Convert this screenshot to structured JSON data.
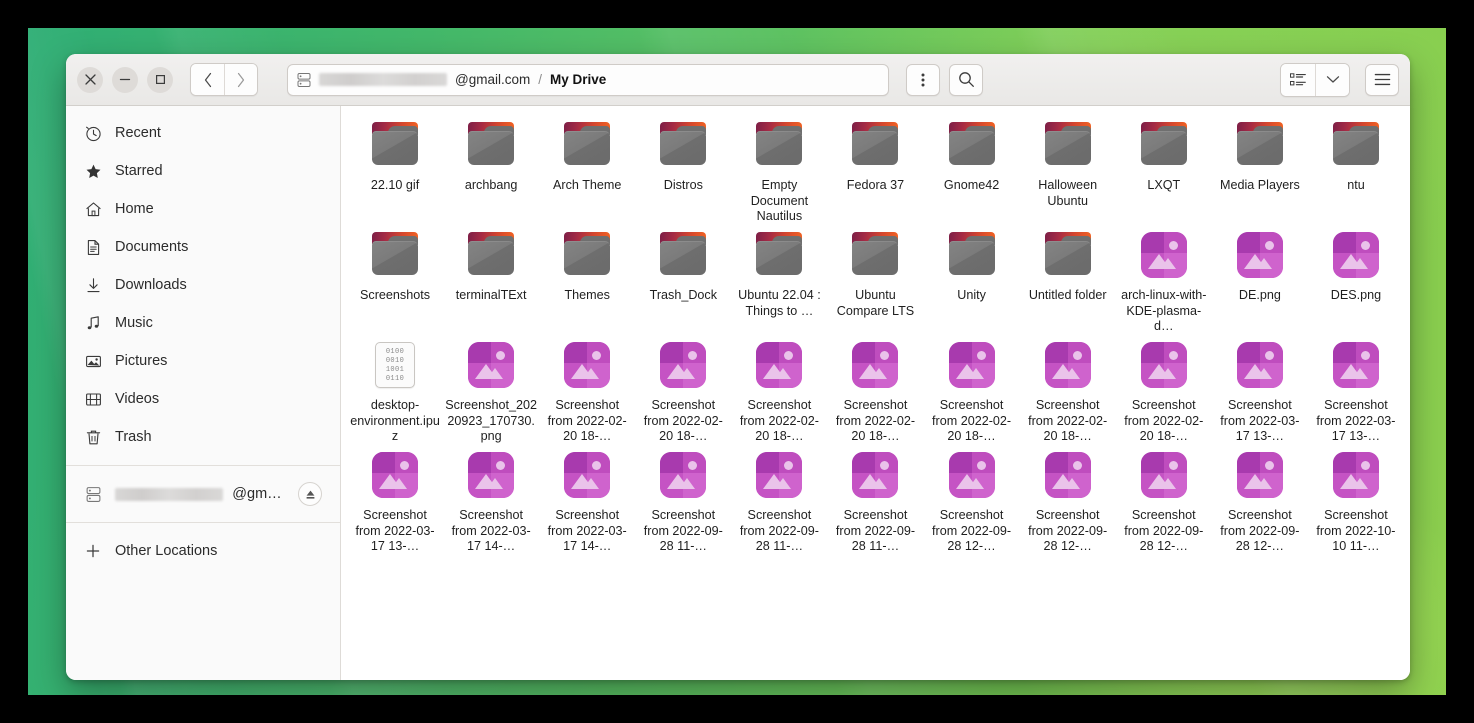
{
  "window": {
    "controls": {
      "close": "×",
      "minimize": "−",
      "maximize": "□"
    },
    "nav": {
      "back": "‹",
      "forward": "›"
    }
  },
  "pathbar": {
    "icon": "drive-icon",
    "account_redacted": true,
    "account_suffix": "@gmail.com",
    "separator": "/",
    "current": "My Drive"
  },
  "toolbar": {
    "menu_label": "⋮",
    "search_label": "search-icon",
    "view_list_label": "list-view-icon",
    "view_dropdown_label": "⌄",
    "hamburger_label": "≡"
  },
  "sidebar": {
    "items": [
      {
        "label": "Recent",
        "icon": "clock-icon"
      },
      {
        "label": "Starred",
        "icon": "star-icon"
      },
      {
        "label": "Home",
        "icon": "home-icon"
      },
      {
        "label": "Documents",
        "icon": "document-icon"
      },
      {
        "label": "Downloads",
        "icon": "download-icon"
      },
      {
        "label": "Music",
        "icon": "music-note-icon"
      },
      {
        "label": "Pictures",
        "icon": "picture-icon"
      },
      {
        "label": "Videos",
        "icon": "film-icon"
      },
      {
        "label": "Trash",
        "icon": "trash-icon"
      }
    ],
    "mount": {
      "label": "@gma…",
      "icon": "drive-icon",
      "eject": "eject-icon",
      "redacted": true
    },
    "other_locations": {
      "label": "Other Locations",
      "icon": "plus-icon"
    }
  },
  "files": [
    {
      "name": "22.10 gif",
      "type": "folder"
    },
    {
      "name": "archbang",
      "type": "folder"
    },
    {
      "name": "Arch Theme",
      "type": "folder"
    },
    {
      "name": "Distros",
      "type": "folder"
    },
    {
      "name": "Empty Document Nautilus",
      "type": "folder"
    },
    {
      "name": "Fedora 37",
      "type": "folder"
    },
    {
      "name": "Gnome42",
      "type": "folder"
    },
    {
      "name": "Halloween Ubuntu",
      "type": "folder"
    },
    {
      "name": "LXQT",
      "type": "folder"
    },
    {
      "name": "Media Players",
      "type": "folder"
    },
    {
      "name": "ntu",
      "type": "folder"
    },
    {
      "name": "Screenshots",
      "type": "folder"
    },
    {
      "name": "terminalTExt",
      "type": "folder"
    },
    {
      "name": "Themes",
      "type": "folder"
    },
    {
      "name": "Trash_Dock",
      "type": "folder"
    },
    {
      "name": "Ubuntu 22.04 : Things to …",
      "type": "folder"
    },
    {
      "name": "Ubuntu Compare LTS",
      "type": "folder"
    },
    {
      "name": "Unity",
      "type": "folder"
    },
    {
      "name": "Untitled folder",
      "type": "folder"
    },
    {
      "name": "arch-linux-with-KDE-plasma-d…",
      "type": "image"
    },
    {
      "name": "DE.png",
      "type": "image"
    },
    {
      "name": "DES.png",
      "type": "image"
    },
    {
      "name": "desktop-environment.ipuz",
      "type": "binary"
    },
    {
      "name": "Screenshot_20220923_170730.png",
      "type": "image"
    },
    {
      "name": "Screenshot from 2022-02-20 18-…",
      "type": "image"
    },
    {
      "name": "Screenshot from 2022-02-20 18-…",
      "type": "image"
    },
    {
      "name": "Screenshot from 2022-02-20 18-…",
      "type": "image"
    },
    {
      "name": "Screenshot from 2022-02-20 18-…",
      "type": "image"
    },
    {
      "name": "Screenshot from 2022-02-20 18-…",
      "type": "image"
    },
    {
      "name": "Screenshot from 2022-02-20 18-…",
      "type": "image"
    },
    {
      "name": "Screenshot from 2022-02-20 18-…",
      "type": "image"
    },
    {
      "name": "Screenshot from 2022-03-17 13-…",
      "type": "image"
    },
    {
      "name": "Screenshot from 2022-03-17 13-…",
      "type": "image"
    },
    {
      "name": "Screenshot from 2022-03-17 13-…",
      "type": "image"
    },
    {
      "name": "Screenshot from 2022-03-17 14-…",
      "type": "image"
    },
    {
      "name": "Screenshot from 2022-03-17 14-…",
      "type": "image"
    },
    {
      "name": "Screenshot from 2022-09-28 11-…",
      "type": "image"
    },
    {
      "name": "Screenshot from 2022-09-28 11-…",
      "type": "image"
    },
    {
      "name": "Screenshot from 2022-09-28 11-…",
      "type": "image"
    },
    {
      "name": "Screenshot from 2022-09-28 12-…",
      "type": "image"
    },
    {
      "name": "Screenshot from 2022-09-28 12-…",
      "type": "image"
    },
    {
      "name": "Screenshot from 2022-09-28 12-…",
      "type": "image"
    },
    {
      "name": "Screenshot from 2022-09-28 12-…",
      "type": "image"
    },
    {
      "name": "Screenshot from 2022-10-10 11-…",
      "type": "image"
    }
  ],
  "binary_icon_rows": [
    "0100",
    "0010",
    "1001",
    "0110"
  ],
  "colors": {
    "folder_body": "#767676",
    "folder_tab_start": "#7d1f46",
    "folder_tab_end": "#f26322",
    "image_icon": "#c24fc0",
    "wallpaper_start": "#2fae75",
    "wallpaper_end": "#8ed04e",
    "headerbar": "#eeedeb",
    "sidebar": "#fafafa"
  }
}
